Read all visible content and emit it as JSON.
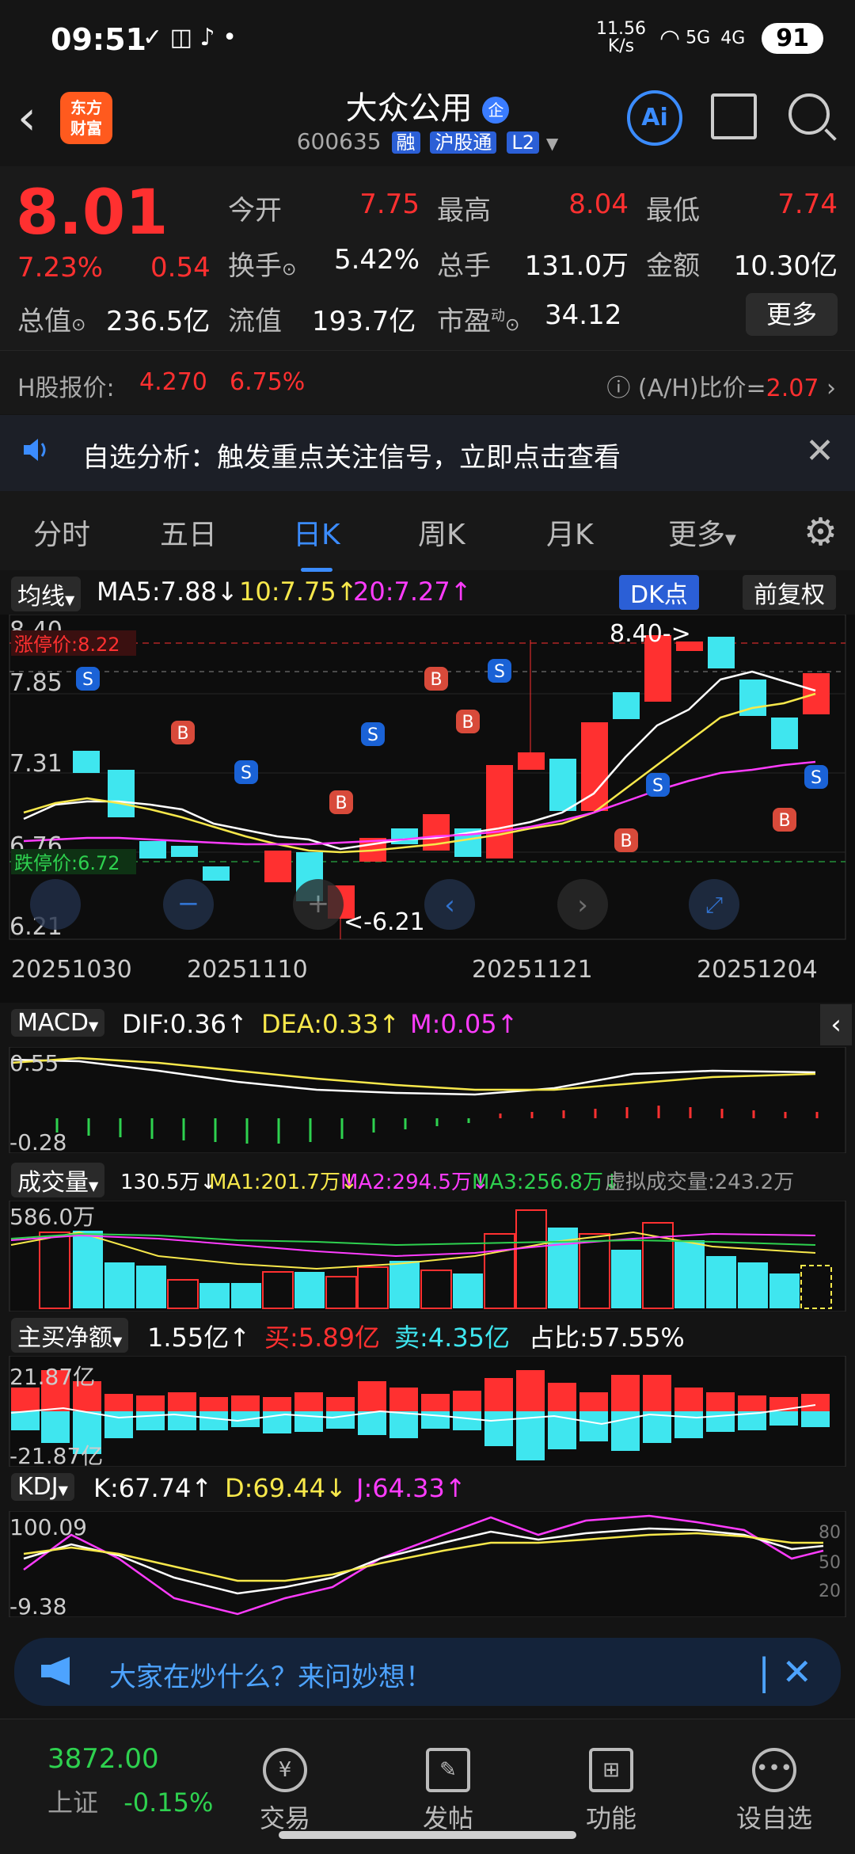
{
  "status_bar": {
    "time": "09:51",
    "net_speed_top": "11.56",
    "net_speed_unit": "K/s",
    "signal1": "5G",
    "signal2": "4G",
    "battery": "91"
  },
  "header": {
    "back": "‹",
    "logo_line1": "东方",
    "logo_line2": "财富",
    "title": "大众公用",
    "title_tag": "企",
    "code": "600635",
    "badge1": "融",
    "badge2": "沪股通",
    "badge3": "L2",
    "ai_label": "Ai"
  },
  "quote": {
    "price": "8.01",
    "pct": "7.23%",
    "change": "0.54",
    "open_label": "今开",
    "open": "7.75",
    "high_label": "最高",
    "high": "8.04",
    "low_label": "最低",
    "low": "7.74",
    "turnover_label": "换手",
    "turnover": "5.42%",
    "volume_label": "总手",
    "volume": "131.0万",
    "amount_label": "金额",
    "amount": "10.30亿",
    "mcap_label": "总值",
    "mcap": "236.5亿",
    "float_label": "流值",
    "float": "193.7亿",
    "pe_label": "市盈",
    "pe_sup": "动",
    "pe": "34.12",
    "more": "更多"
  },
  "hshare": {
    "label": "H股报价:",
    "price": "4.270",
    "pct": "6.75%",
    "ratio_label": "(A/H)比价=",
    "ratio": "2.07"
  },
  "notice": {
    "text": "自选分析：触发重点关注信号，立即点击查看"
  },
  "tabs": [
    "分时",
    "五日",
    "日K",
    "周K",
    "月K",
    "更多"
  ],
  "kline": {
    "ma_selector": "均线",
    "ma5": "MA5:7.88",
    "ma10": "10:7.75",
    "ma20": "20:7.27",
    "dk_button": "DK点",
    "adjust_button": "前复权",
    "y_top": "8.40",
    "y2": "7.85",
    "y3": "7.31",
    "y4": "6.76",
    "y_bottom": "6.21",
    "limit_up": "涨停价:8.22",
    "limit_down": "跌停价:6.72",
    "max_label": "8.40->",
    "min_label": "<-6.21",
    "dates": [
      "20251030",
      "20251110",
      "20251121",
      "20251204"
    ]
  },
  "macd": {
    "selector": "MACD",
    "dif": "DIF:0.36",
    "dea": "DEA:0.33",
    "m": "M:0.05",
    "y_top": "0.55",
    "y_bottom": "-0.28"
  },
  "volume": {
    "selector": "成交量",
    "vol": "130.5万",
    "ma1": "MA1:201.7万",
    "ma2": "MA2:294.5万",
    "ma3": "MA3:256.8万",
    "virtual": "虚拟成交量:243.2万",
    "y_top": "586.0万"
  },
  "netbuy": {
    "selector": "主买净额",
    "net": "1.55亿",
    "buy": "买:5.89亿",
    "sell": "卖:4.35亿",
    "ratio": "占比:57.55%",
    "y_top": "21.87亿",
    "y_bottom": "-21.87亿"
  },
  "kdj": {
    "selector": "KDJ",
    "k": "K:67.74",
    "d": "D:69.44",
    "j": "J:64.33",
    "y_top": "100.09",
    "y_bottom": "-9.38",
    "r80": "80",
    "r50": "50",
    "r20": "20"
  },
  "banner": {
    "text": "大家在炒什么？来问妙想！"
  },
  "tabbar": {
    "index_value": "3872.00",
    "index_name": "上证",
    "index_pct": "-0.15%",
    "trade": "交易",
    "post": "发帖",
    "func": "功能",
    "watch": "设自选"
  },
  "colors": {
    "up": "#ff3030",
    "down": "#3fe6ef",
    "accent": "#3b8cff"
  }
}
